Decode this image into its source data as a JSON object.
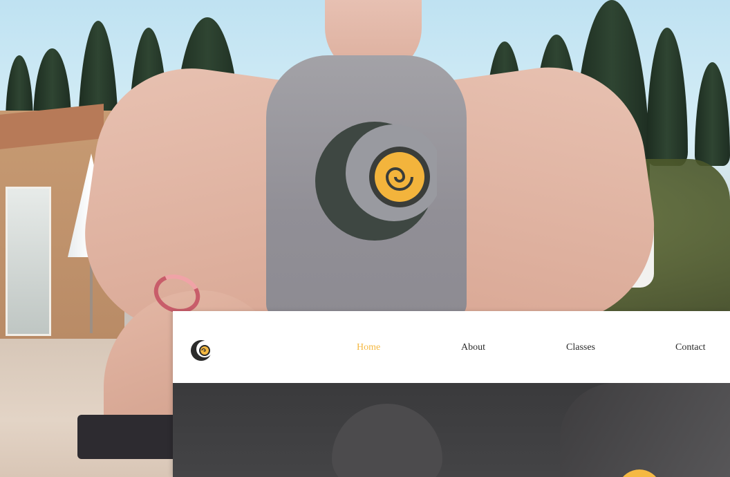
{
  "nav": {
    "items": [
      {
        "label": "Home",
        "active": true
      },
      {
        "label": "About",
        "active": false
      },
      {
        "label": "Classes",
        "active": false
      },
      {
        "label": "Contact",
        "active": false
      }
    ]
  },
  "brand": {
    "logo_icon": "crescent-spiral-icon",
    "accent": "#f5b942",
    "dark": "#2b2b2b"
  }
}
